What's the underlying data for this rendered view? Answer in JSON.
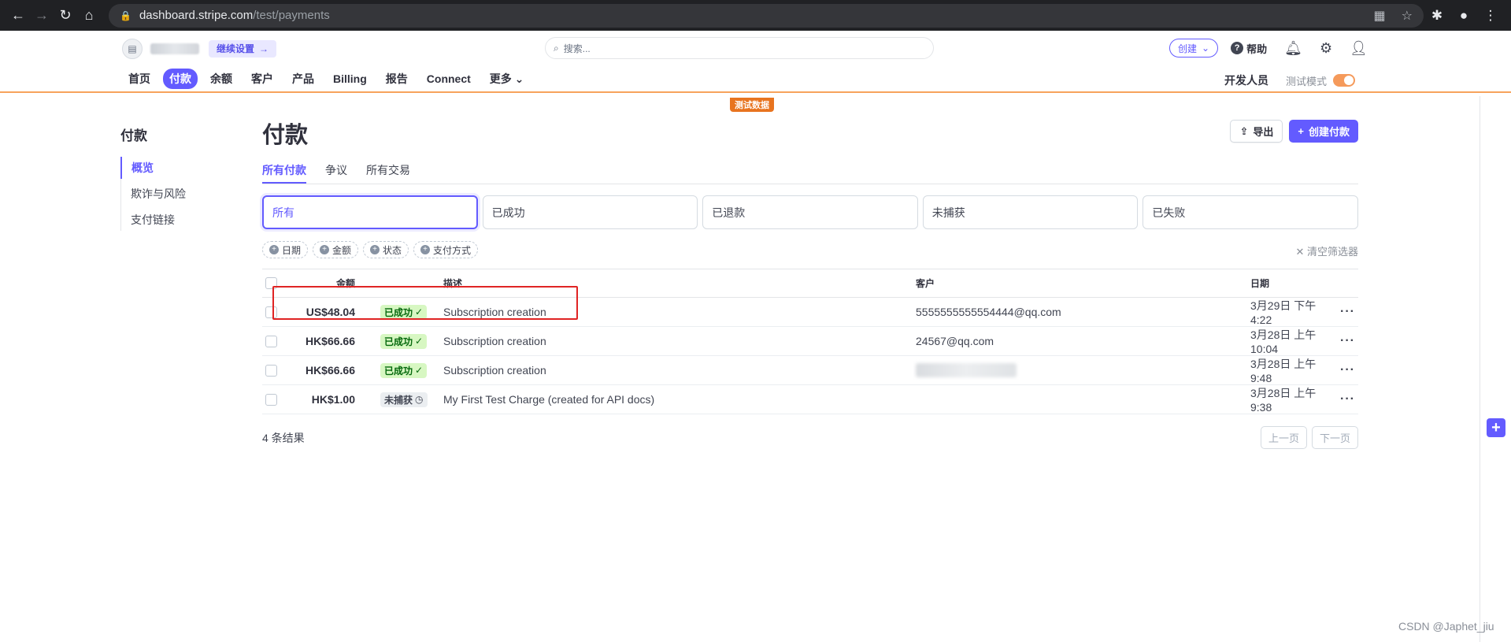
{
  "browser": {
    "url_host": "dashboard.stripe.com",
    "url_path": "/test/payments"
  },
  "topbar": {
    "continue_setup": "继续设置",
    "search_placeholder": "搜索...",
    "create": "创建",
    "help": "帮助"
  },
  "nav": {
    "items": [
      "首页",
      "付款",
      "余额",
      "客户",
      "产品",
      "Billing",
      "报告",
      "Connect",
      "更多"
    ],
    "active": "付款",
    "developer": "开发人员",
    "test_mode": "测试模式",
    "test_data_tag": "测试数据"
  },
  "sidebar": {
    "title": "付款",
    "items": [
      "概览",
      "欺诈与风险",
      "支付链接"
    ]
  },
  "main": {
    "title": "付款",
    "export": "导出",
    "create_payment": "创建付款",
    "tabs": [
      "所有付款",
      "争议",
      "所有交易"
    ],
    "status_cards": [
      "所有",
      "已成功",
      "已退款",
      "未捕获",
      "已失败"
    ],
    "filters": [
      "日期",
      "金额",
      "状态",
      "支付方式"
    ],
    "clear_filters": "清空筛选器",
    "columns": {
      "amount": "金额",
      "description": "描述",
      "customer": "客户",
      "date": "日期"
    },
    "rows": [
      {
        "amount": "US$48.04",
        "status": "已成功",
        "status_type": "succeeded",
        "description": "Subscription creation",
        "customer": "5555555555554444@qq.com",
        "date": "3月29日 下午4:22"
      },
      {
        "amount": "HK$66.66",
        "status": "已成功",
        "status_type": "succeeded",
        "description": "Subscription creation",
        "customer": "24567@qq.com",
        "date": "3月28日 上午10:04"
      },
      {
        "amount": "HK$66.66",
        "status": "已成功",
        "status_type": "succeeded",
        "description": "Subscription creation",
        "customer": "",
        "date": "3月28日 上午9:48"
      },
      {
        "amount": "HK$1.00",
        "status": "未捕获",
        "status_type": "uncaptured",
        "description": "My First Test Charge (created for API docs)",
        "customer": "",
        "date": "3月28日 上午9:38"
      }
    ],
    "results_count": "4 条结果",
    "prev_page": "上一页",
    "next_page": "下一页"
  },
  "watermark": "CSDN @Japhet_jiu",
  "colors": {
    "accent": "#635bff",
    "test_mode": "#e8741f",
    "success_bg": "#d7f7c2",
    "highlight": "#e02424"
  }
}
